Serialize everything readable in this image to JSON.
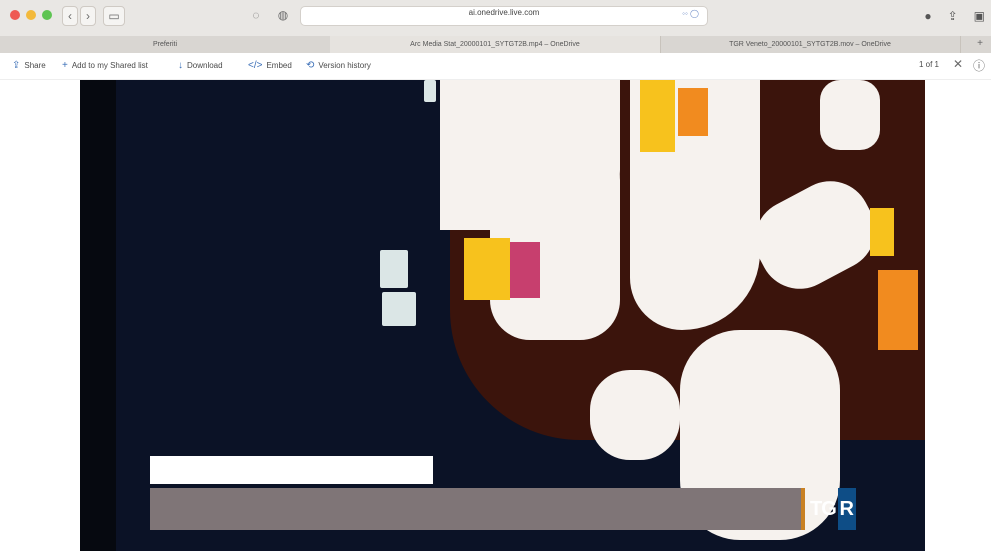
{
  "browser": {
    "address": "ai.onedrive.live.com",
    "tabs": [
      {
        "label": "Preferiti"
      },
      {
        "label": "Arc Media Stat_20000101_SYTGT2B.mp4 – OneDrive"
      },
      {
        "label": "TGR Veneto_20000101_SYTGT2B.mov – OneDrive"
      }
    ],
    "new_tab_label": "+"
  },
  "toolbar": {
    "share_label": "Share",
    "add_shared_label": "Add to my Shared list",
    "download_label": "Download",
    "embed_label": "Embed",
    "version_label": "Version history",
    "pager": "1 of 1"
  },
  "video": {
    "logo_tg": "TG",
    "logo_r": "R",
    "accent_colors": {
      "yellow": "#f7c21d",
      "orange": "#f18b1f",
      "pink": "#c73f6e",
      "blue": "#0e4d86"
    }
  },
  "icons": [
    "back-icon",
    "forward-icon",
    "sidebar-icon",
    "shield-icon",
    "reader-icon",
    "share-icon",
    "add-icon",
    "download-icon",
    "embed-icon",
    "history-icon",
    "close-icon",
    "info-icon"
  ]
}
